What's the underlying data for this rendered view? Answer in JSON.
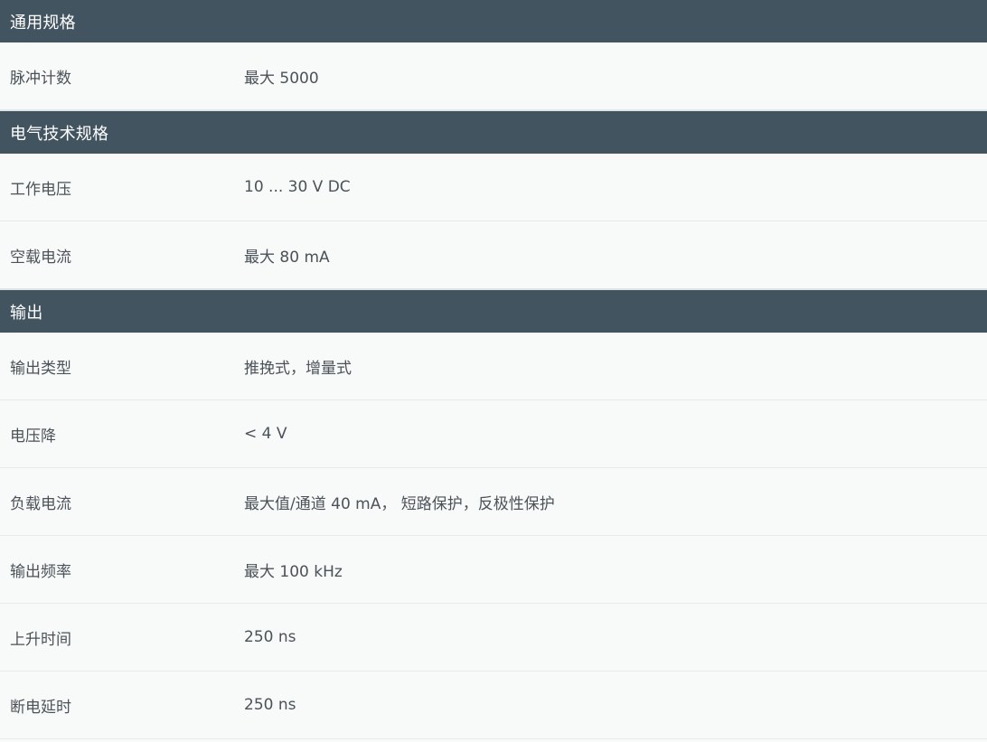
{
  "sections": [
    {
      "title": "通用规格",
      "rows": [
        {
          "label": "脉冲计数",
          "value": "最大 5000"
        }
      ]
    },
    {
      "title": "电气技术规格",
      "rows": [
        {
          "label": "工作电压",
          "value": "10 ... 30 V DC"
        },
        {
          "label": "空载电流",
          "value": "最大 80 mA"
        }
      ]
    },
    {
      "title": "输出",
      "rows": [
        {
          "label": "输出类型",
          "value": "推挽式，增量式"
        },
        {
          "label": "电压降",
          "value": "< 4 V"
        },
        {
          "label": "负载电流",
          "value": "最大值/通道 40 mA， 短路保护，反极性保护"
        },
        {
          "label": "输出频率",
          "value": "最大 100 kHz"
        },
        {
          "label": "上升时间",
          "value": "250 ns"
        },
        {
          "label": "断电延时",
          "value": "250 ns"
        }
      ]
    }
  ]
}
